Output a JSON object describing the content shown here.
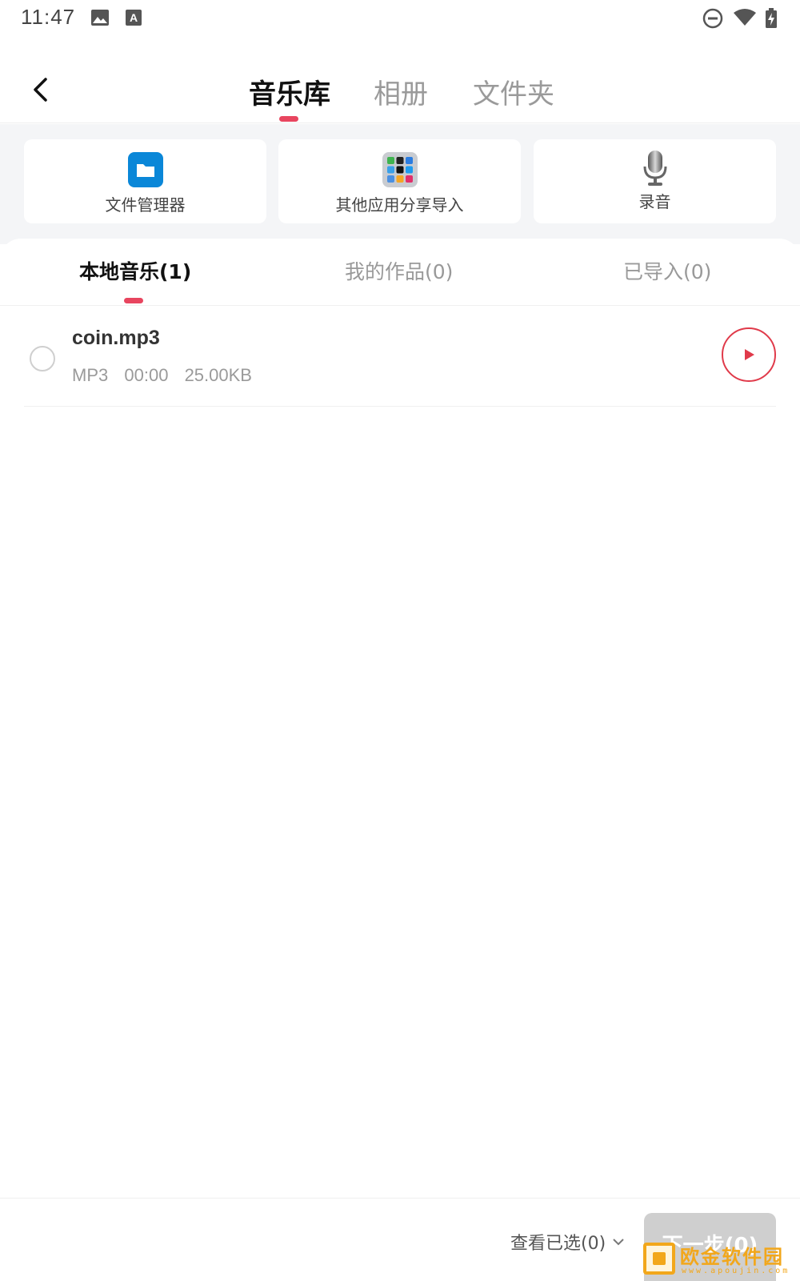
{
  "status_bar": {
    "time": "11:47",
    "icons": [
      "image-icon",
      "text-a-icon",
      "do-not-disturb-icon",
      "wifi-icon",
      "battery-charging-icon"
    ]
  },
  "top_nav": {
    "tabs": [
      {
        "label": "音乐库",
        "active": true
      },
      {
        "label": "相册",
        "active": false
      },
      {
        "label": "文件夹",
        "active": false
      }
    ]
  },
  "import_sources": [
    {
      "label": "文件管理器",
      "icon": "folder-icon"
    },
    {
      "label": "其他应用分享导入",
      "icon": "app-grid-icon"
    },
    {
      "label": "录音",
      "icon": "microphone-icon"
    }
  ],
  "sub_tabs": [
    {
      "label": "本地音乐(1)",
      "active": true
    },
    {
      "label": "我的作品(0)",
      "active": false
    },
    {
      "label": "已导入(0)",
      "active": false
    }
  ],
  "files": [
    {
      "name": "coin.mp3",
      "format": "MP3",
      "duration": "00:00",
      "size": "25.00KB"
    }
  ],
  "bottom_bar": {
    "view_selected": "查看已选(0)",
    "next": "下一步(0)"
  },
  "watermark": {
    "text": "欧金软件园",
    "url": "www.apoujin.com"
  },
  "colors": {
    "accent": "#e8455f",
    "play": "#e03a4a",
    "folder_blue": "#0a87d8",
    "disabled": "#cfcfcf"
  }
}
